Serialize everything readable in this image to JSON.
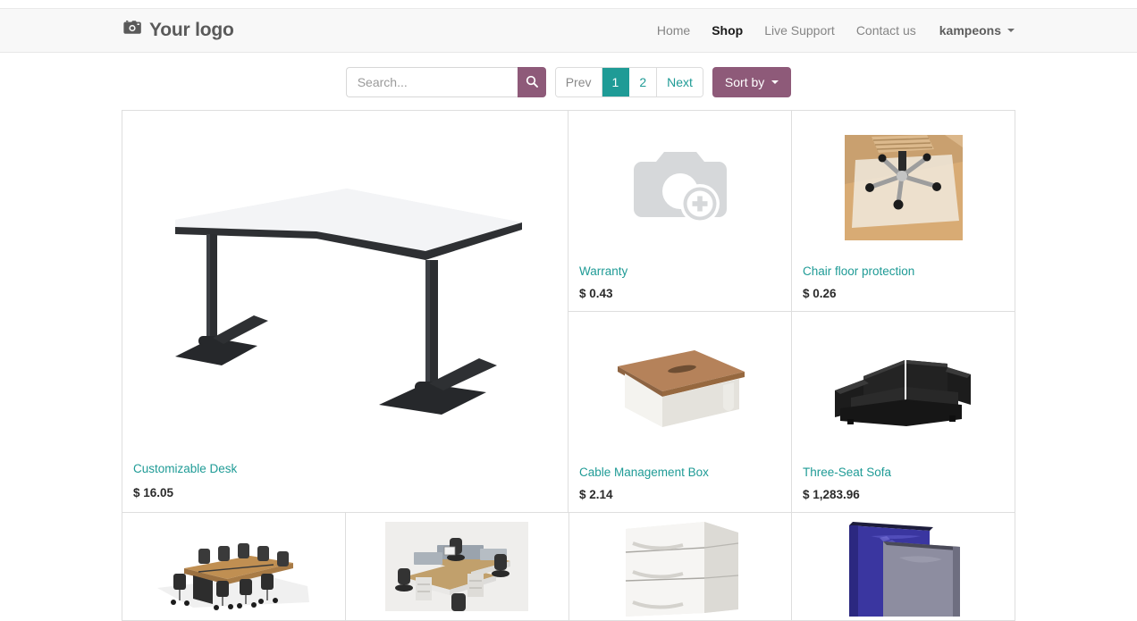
{
  "header": {
    "brand": "Your logo",
    "brand_icon": "camera-icon",
    "nav": [
      {
        "label": "Home",
        "active": false
      },
      {
        "label": "Shop",
        "active": true
      },
      {
        "label": "Live Support",
        "active": false
      },
      {
        "label": "Contact us",
        "active": false
      }
    ],
    "user": "kampeons"
  },
  "toolbar": {
    "search_placeholder": "Search...",
    "search_value": "",
    "search_icon": "magnifier-icon",
    "pagination": {
      "prev": "Prev",
      "pages": [
        "1",
        "2"
      ],
      "current": "1",
      "next": "Next"
    },
    "sort_label": "Sort by"
  },
  "theme": {
    "accent_purple": "#8e5a79",
    "accent_teal": "#1f9b96",
    "link_color": "#1f9b96",
    "navbar_bg": "#f8f8f8",
    "border": "#dedede"
  },
  "products": [
    {
      "name": "Customizable Desk",
      "price": "$ 16.05",
      "image": "white-l-shaped-desk-black-legs",
      "has_image": true
    },
    {
      "name": "Warranty",
      "price": "$ 0.43",
      "image": "camera-plus-placeholder",
      "has_image": false
    },
    {
      "name": "Chair floor protection",
      "price": "$ 0.26",
      "image": "office-chair-on-floor-mat",
      "has_image": true
    },
    {
      "name": "Cable Management Box",
      "price": "$ 2.14",
      "image": "white-box-with-wood-lid",
      "has_image": true
    },
    {
      "name": "Three-Seat Sofa",
      "price": "$ 1,283.96",
      "image": "black-leather-three-seat-sofa",
      "has_image": true
    }
  ],
  "products_partial_row": [
    {
      "image": "conference-table-with-chairs",
      "has_image": true
    },
    {
      "image": "office-workstation-cubicles",
      "has_image": true
    },
    {
      "image": "white-three-drawer-cabinet",
      "has_image": true
    },
    {
      "image": "blue-and-grey-panels",
      "has_image": true
    }
  ]
}
